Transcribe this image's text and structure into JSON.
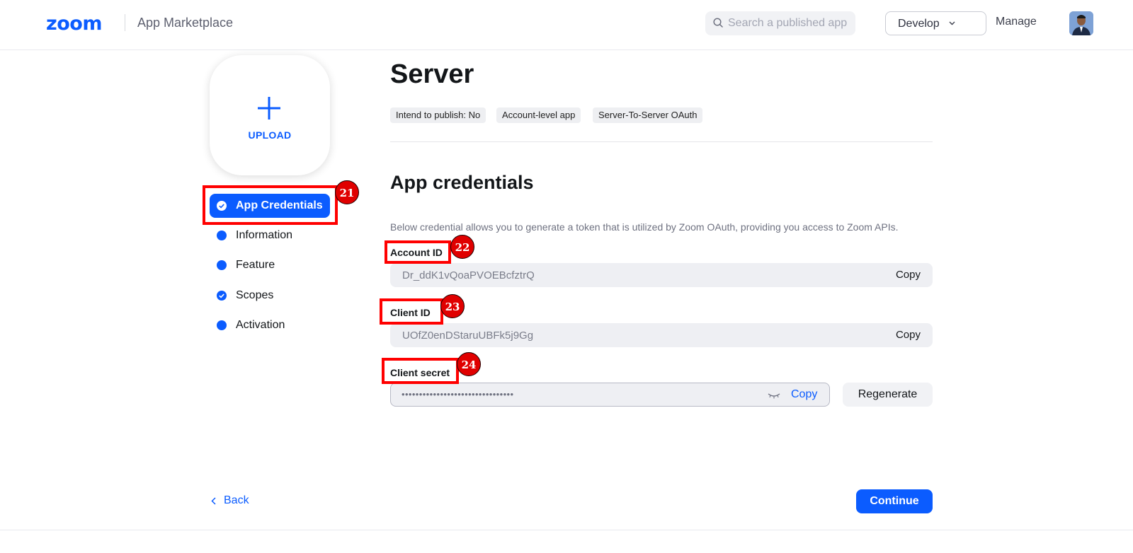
{
  "header": {
    "logo_text": "zoom",
    "app_name": "App Marketplace",
    "search_placeholder": "Search a published app",
    "develop_label": "Develop",
    "manage_label": "Manage"
  },
  "sidebar": {
    "upload_label": "UPLOAD",
    "steps": [
      {
        "label": "App Credentials",
        "state": "active-complete"
      },
      {
        "label": "Information",
        "state": "pending"
      },
      {
        "label": "Feature",
        "state": "pending"
      },
      {
        "label": "Scopes",
        "state": "complete"
      },
      {
        "label": "Activation",
        "state": "pending"
      }
    ]
  },
  "main": {
    "title": "Server",
    "tags": [
      "Intend to publish: No",
      "Account-level app",
      "Server-To-Server OAuth"
    ],
    "section_title": "App credentials",
    "description": "Below credential allows you to generate a token that is utilized by Zoom OAuth, providing you access to Zoom APIs.",
    "account_id": {
      "label": "Account ID",
      "value": "Dr_ddK1vQoaPVOEBcfztrQ",
      "copy_label": "Copy"
    },
    "client_id": {
      "label": "Client ID",
      "value": "UOfZ0enDStaruUBFk5j9Gg",
      "copy_label": "Copy"
    },
    "client_secret": {
      "label": "Client secret",
      "value": "••••••••••••••••••••••••••••••••",
      "copy_label": "Copy",
      "regenerate_label": "Regenerate"
    }
  },
  "footer": {
    "back_label": "Back",
    "continue_label": "Continue"
  },
  "annotations": [
    "21",
    "22",
    "23",
    "24"
  ],
  "colors": {
    "accent": "#0b5cff",
    "annotation": "#ff0000"
  }
}
